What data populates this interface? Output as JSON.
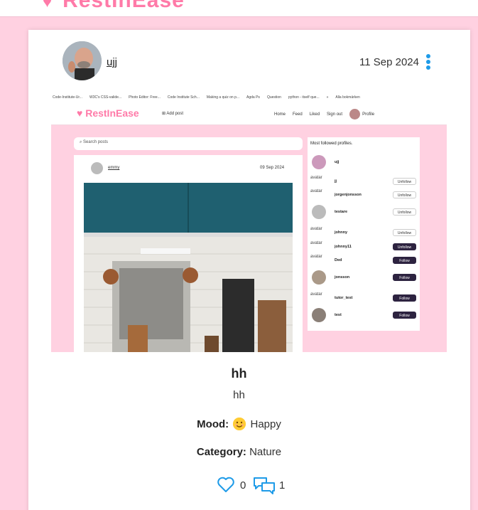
{
  "app": {
    "brand": "RestInEase"
  },
  "post": {
    "author": "ujj",
    "date": "11 Sep 2024",
    "title": "hh",
    "body": "hh",
    "mood_label": "Mood:",
    "mood_value": "Happy",
    "category_label": "Category:",
    "category_value": "Nature",
    "likes": "0",
    "comments": "1"
  },
  "screenshot": {
    "bookmarks": [
      "Code-Institute-Ur...",
      "W3C's CSS-valide...",
      "Photo Editor: Free...",
      "Code Institute Sch...",
      "Making a quiz on p...",
      "Agda Ps",
      "Question",
      "python - itself que...",
      "»",
      "Alla bokmärken"
    ],
    "brand": "RestInEase",
    "add_post": "Add post",
    "nav": [
      "Home",
      "Feed",
      "Liked",
      "Sign out",
      "Profile"
    ],
    "search_placeholder": "Search posts",
    "post_user": "emmy",
    "post_date": "09 Sep 2024",
    "sidebar_title": "Most followed profiles.",
    "profiles": [
      {
        "name": "ujj",
        "alt": "",
        "button": ""
      },
      {
        "name": "jj",
        "alt": "avatar",
        "button": "Unfollow"
      },
      {
        "name": "jorgenjonsson",
        "alt": "avatar",
        "button": "Unfollow"
      },
      {
        "name": "testare",
        "alt": "",
        "button": "Unfollow"
      },
      {
        "name": "johnny",
        "alt": "avatar",
        "button": "Unfollow"
      },
      {
        "name": "johnny11",
        "alt": "avatar",
        "button": "Unfollow"
      },
      {
        "name": "Ded",
        "alt": "avatar",
        "button": "Follow"
      },
      {
        "name": "jonsson",
        "alt": "",
        "button": "Follow"
      },
      {
        "name": "tutor_test",
        "alt": "avatar",
        "button": "Follow"
      },
      {
        "name": "test",
        "alt": "",
        "button": "Follow"
      }
    ]
  },
  "colors": {
    "background": "#ffd1e1",
    "brand_pink": "#ff7aa8",
    "accent_blue": "#1e9be8",
    "follow_dark": "#2d2340"
  }
}
